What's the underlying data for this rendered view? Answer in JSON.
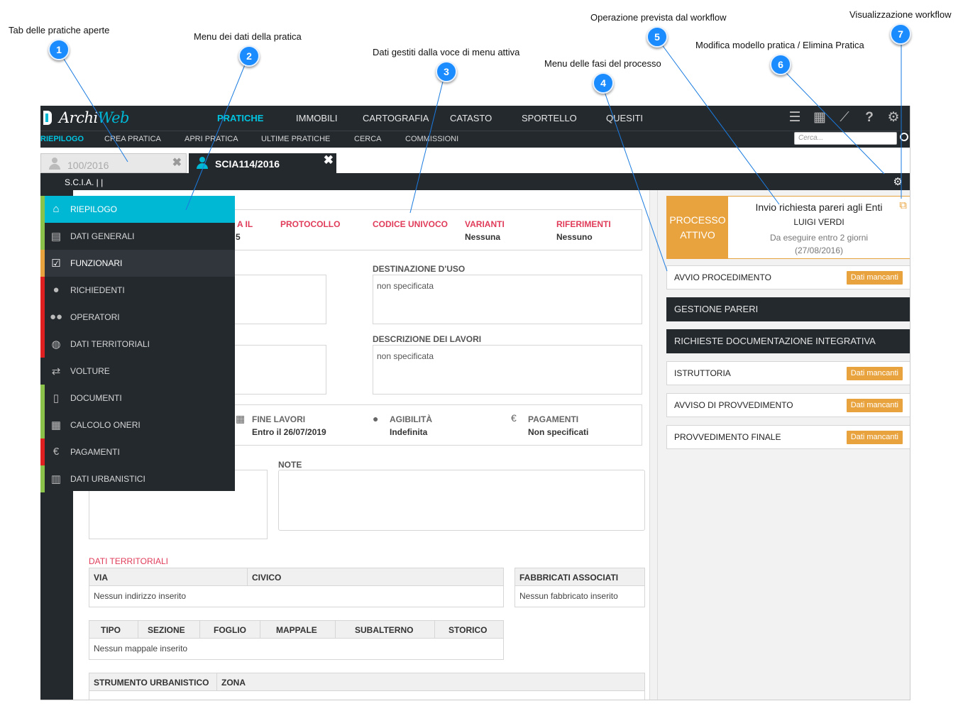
{
  "callouts": [
    {
      "num": "1",
      "label": "Tab delle pratiche aperte"
    },
    {
      "num": "2",
      "label": "Menu dei dati della pratica"
    },
    {
      "num": "3",
      "label": "Dati gestiti dalla voce di menu attiva"
    },
    {
      "num": "4",
      "label": "Menu delle fasi del processo"
    },
    {
      "num": "5",
      "label": "Operazione prevista dal workflow"
    },
    {
      "num": "6",
      "label": "Modifica modello pratica / Elimina Pratica"
    },
    {
      "num": "7",
      "label": "Visualizzazione workflow"
    }
  ],
  "app": {
    "logo_a": "Archi",
    "logo_b": "Web",
    "main_nav": [
      "PRATICHE",
      "IMMOBILI",
      "CARTOGRAFIA",
      "CATASTO",
      "SPORTELLO",
      "QUESITI"
    ],
    "top_icons": [
      "list-icon",
      "calendar-icon",
      "chart-icon",
      "help-icon",
      "gear-icon",
      "user-icon"
    ],
    "sub_nav": [
      "RIEPILOGO",
      "CREA PRATICA",
      "APRI PRATICA",
      "ULTIME PRATICHE",
      "CERCA",
      "COMMISSIONI"
    ],
    "search_placeholder": "Cerca..."
  },
  "tabs": [
    {
      "label": "100/2016",
      "close": "✖"
    },
    {
      "label": "SCIA114/2016",
      "close": "✖"
    }
  ],
  "practice_title": "S.C.I.A. | |",
  "menu": [
    {
      "label": "RIEPILOGO",
      "icon": "home-icon",
      "stripe": "#8bc34a"
    },
    {
      "label": "DATI GENERALI",
      "icon": "list-alt-icon",
      "stripe": "#8bc34a"
    },
    {
      "label": "FUNZIONARI",
      "icon": "check-square-icon",
      "stripe": "#e8a33e"
    },
    {
      "label": "RICHIEDENTI",
      "icon": "user-icon",
      "stripe": "#e02020"
    },
    {
      "label": "OPERATORI",
      "icon": "users-icon",
      "stripe": "#e02020"
    },
    {
      "label": "DATI TERRITORIALI",
      "icon": "globe-icon",
      "stripe": "#e02020"
    },
    {
      "label": "VOLTURE",
      "icon": "exchange-icon",
      "stripe": ""
    },
    {
      "label": "DOCUMENTI",
      "icon": "file-icon",
      "stripe": "#8bc34a"
    },
    {
      "label": "CALCOLO ONERI",
      "icon": "calculator-icon",
      "stripe": "#8bc34a"
    },
    {
      "label": "PAGAMENTI",
      "icon": "euro-icon",
      "stripe": "#e02020"
    },
    {
      "label": "DATI URBANISTICI",
      "icon": "building-icon",
      "stripe": "#8bc34a"
    }
  ],
  "summary": {
    "partial_date_label": "A IL",
    "partial_date_value": "5",
    "protocol_label": "PROTOCOLLO",
    "code_label": "CODICE UNIVOCO",
    "variants_label": "VARIANTI",
    "variants_value": "Nessuna",
    "refs_label": "RIFERIMENTI",
    "refs_value": "Nessuno",
    "use_label": "DESTINAZIONE D'USO",
    "use_value": "non specificata",
    "works_label": "DESCRIZIONE DEI LAVORI",
    "works_value": "non specificata",
    "end_label": "FINE LAVORI",
    "end_value": "Entro il 26/07/2019",
    "agib_label": "AGIBILITÀ",
    "agib_value": "Indefinita",
    "pay_label": "PAGAMENTI",
    "pay_value": "Non specificati",
    "euro_symbol": "€",
    "notes_label": "NOTE",
    "territorial_title": "DATI TERRITORIALI",
    "address_table": {
      "headers": [
        "VIA",
        "CIVICO"
      ],
      "empty": "Nessun indirizzo inserito"
    },
    "buildings_table": {
      "headers": [
        "FABBRICATI ASSOCIATI"
      ],
      "empty": "Nessun fabbricato inserito"
    },
    "cadastre_table": {
      "headers": [
        "TIPO",
        "SEZIONE",
        "FOGLIO",
        "MAPPALE",
        "SUBALTERNO",
        "STORICO"
      ],
      "empty": "Nessun mappale inserito"
    },
    "urban_table": {
      "headers": [
        "STRUMENTO URBANISTICO",
        "ZONA"
      ]
    }
  },
  "workflow": {
    "active_tag_1": "PROCESSO",
    "active_tag_2": "ATTIVO",
    "task_title": "Invio richiesta pareri agli Enti",
    "assignee": "LUIGI VERDI",
    "due_1": "Da eseguire entro 2 giorni",
    "due_2": "(27/08/2016)",
    "accent": "#e8a33e",
    "phases": [
      {
        "label": "AVVIO PROCEDIMENTO",
        "badge": "Dati mancanti",
        "dark": false
      },
      {
        "label": "GESTIONE PARERI",
        "badge": "",
        "dark": true
      },
      {
        "label": "RICHIESTE DOCUMENTAZIONE INTEGRATIVA",
        "badge": "",
        "dark": true
      },
      {
        "label": "ISTRUTTORIA",
        "badge": "Dati mancanti",
        "dark": false
      },
      {
        "label": "AVVISO DI PROVVEDIMENTO",
        "badge": "Dati mancanti",
        "dark": false
      },
      {
        "label": "PROVVEDIMENTO FINALE",
        "badge": "Dati mancanti",
        "dark": false
      }
    ]
  }
}
